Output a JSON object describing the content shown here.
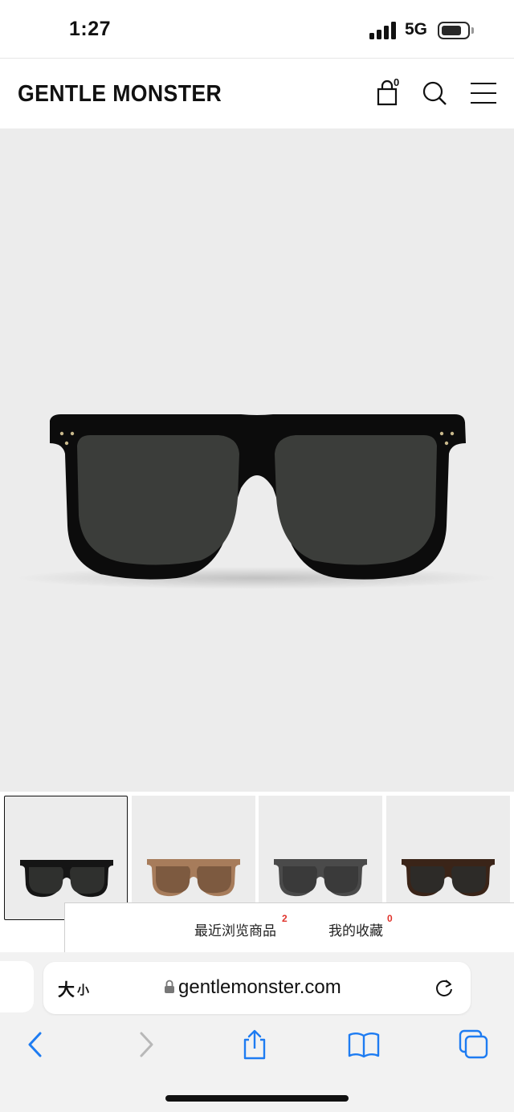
{
  "status_bar": {
    "time": "1:27",
    "network": "5G"
  },
  "header": {
    "brand": "GENTLE MONSTER",
    "cart_count": "0"
  },
  "thumbnails": [
    {
      "name": "black",
      "frame": "#151515",
      "lens": "#2f302e",
      "active": true
    },
    {
      "name": "brown",
      "frame": "#a77c5b",
      "lens": "#7d5a40",
      "active": false
    },
    {
      "name": "grey",
      "frame": "#4a4a4a",
      "lens": "#3a3a3a",
      "active": false
    },
    {
      "name": "tortoise",
      "frame": "#3a2418",
      "lens": "#2d2b28",
      "active": false
    }
  ],
  "recent_bar": {
    "recent_label": "最近浏览商品",
    "recent_count": "2",
    "favorites_label": "我的收藏",
    "favorites_count": "0"
  },
  "address_bar": {
    "text_size_big": "大",
    "text_size_small": "小",
    "url": "gentlemonster.com"
  },
  "colors": {
    "hero_bg": "#ececec",
    "badge": "#e0322b",
    "accent_blue": "#1e7cf2"
  },
  "icons": [
    "cart-icon",
    "search-icon",
    "menu-icon",
    "lock-icon",
    "reload-icon",
    "back-icon",
    "forward-icon",
    "share-icon",
    "bookmarks-icon",
    "tabs-icon"
  ]
}
